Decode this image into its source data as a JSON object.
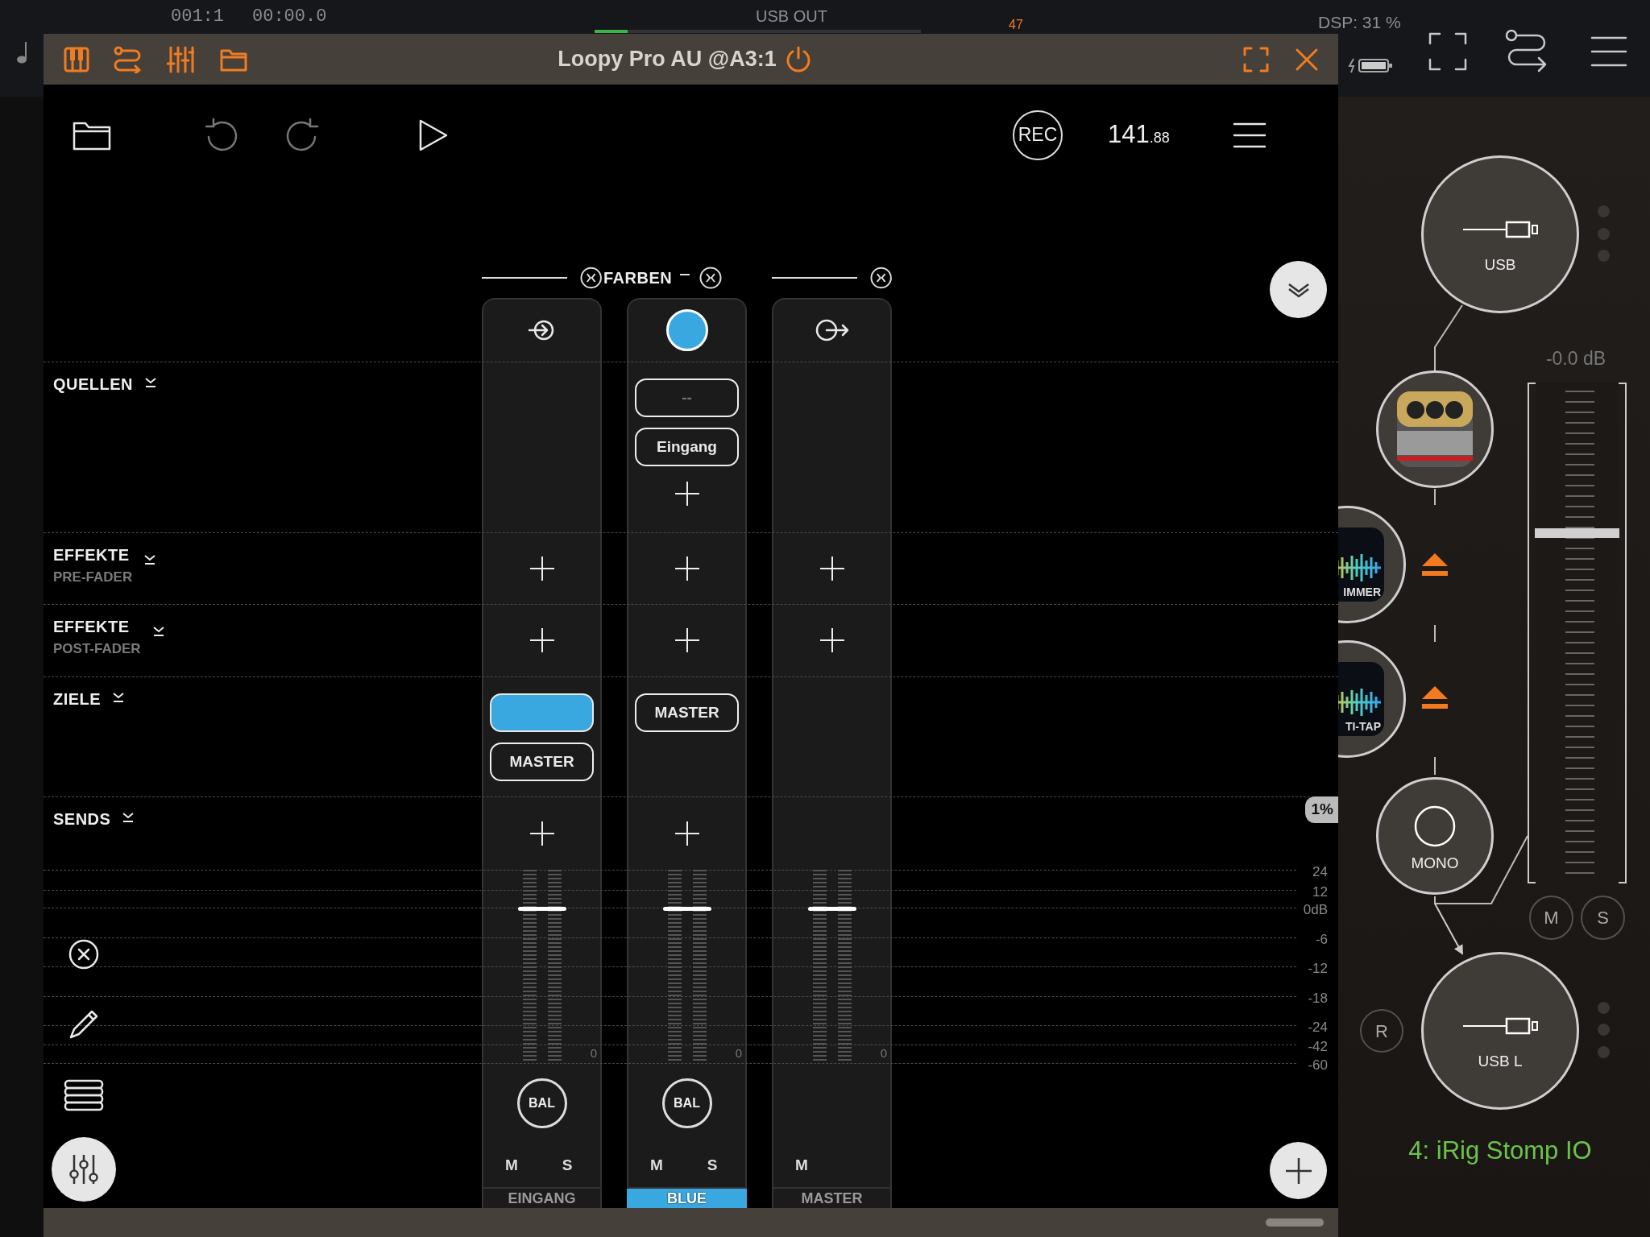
{
  "host": {
    "position": "001:1",
    "time": "00:00.0",
    "output": "USB OUT",
    "output_meter": {
      "level": 0.1
    },
    "peak": "47",
    "dsp": "DSP: 31 %"
  },
  "window": {
    "title": "Loopy Pro AU @A3:1"
  },
  "toolbar": {
    "record": "REC",
    "tempo": "141",
    "tempo_decimals": ".88"
  },
  "sections": [
    {
      "label": "QUELLEN"
    },
    {
      "label": "EFFEKTE",
      "sublabel": "PRE-FADER"
    },
    {
      "label": "EFFEKTE",
      "sublabel": "POST-FADER"
    },
    {
      "label": "ZIELE"
    },
    {
      "label": "SENDS"
    }
  ],
  "channels": [
    {
      "kind": "input",
      "slots": [
        {
          "add": false
        },
        {
          "add": true
        },
        {
          "add": true
        },
        {
          "items": [
            {
              "color": "#3aa8e0"
            },
            {
              "label": "MASTER",
              "disabled": false
            }
          ],
          "add": false
        },
        {
          "add": true
        }
      ],
      "fader": {
        "level": 0.8
      },
      "reading": "0",
      "balance": "BAL",
      "mute": "M",
      "solo": "S",
      "name": "EINGANG"
    },
    {
      "kind": "color",
      "group": "FARBEN",
      "color": "#3aa8e0",
      "slots": [
        {
          "items": [
            {
              "label": "--",
              "disabled": true
            },
            {
              "label": "Eingang",
              "disabled": false
            }
          ],
          "add": true
        },
        {
          "add": true
        },
        {
          "add": true
        },
        {
          "items": [
            {
              "label": "MASTER",
              "disabled": false
            }
          ],
          "add": false
        },
        {
          "add": true
        }
      ],
      "fader": {
        "level": 0.8
      },
      "reading": "0",
      "balance": "BAL",
      "mute": "M",
      "solo": "S",
      "name": "BLUE"
    },
    {
      "kind": "output",
      "slots": [
        {
          "add": false
        },
        {
          "add": true
        },
        {
          "add": true
        },
        {
          "add": false
        },
        {
          "add": false
        }
      ],
      "fader": {
        "level": 0.8
      },
      "reading": "0",
      "mute": "M",
      "name": "MASTER"
    }
  ],
  "db_scale": [
    "24",
    "12",
    "0dB",
    "-6",
    "-12",
    "-18",
    "-24",
    "-42",
    "-60"
  ],
  "load": "1%",
  "routing": {
    "nodes": [
      {
        "kind": "usb",
        "label": "USB"
      },
      {
        "kind": "amp"
      },
      {
        "kind": "wave",
        "label": "IMMER"
      },
      {
        "kind": "wave",
        "label": "TI-TAP"
      },
      {
        "kind": "mono",
        "label": "MONO"
      },
      {
        "kind": "usb",
        "label": "USB L"
      }
    ],
    "output_fader": {
      "reading": "-0.0 dB",
      "level": 0.7
    },
    "mute": "M",
    "solo": "S",
    "record": "R",
    "device": "4: iRig Stomp IO"
  }
}
